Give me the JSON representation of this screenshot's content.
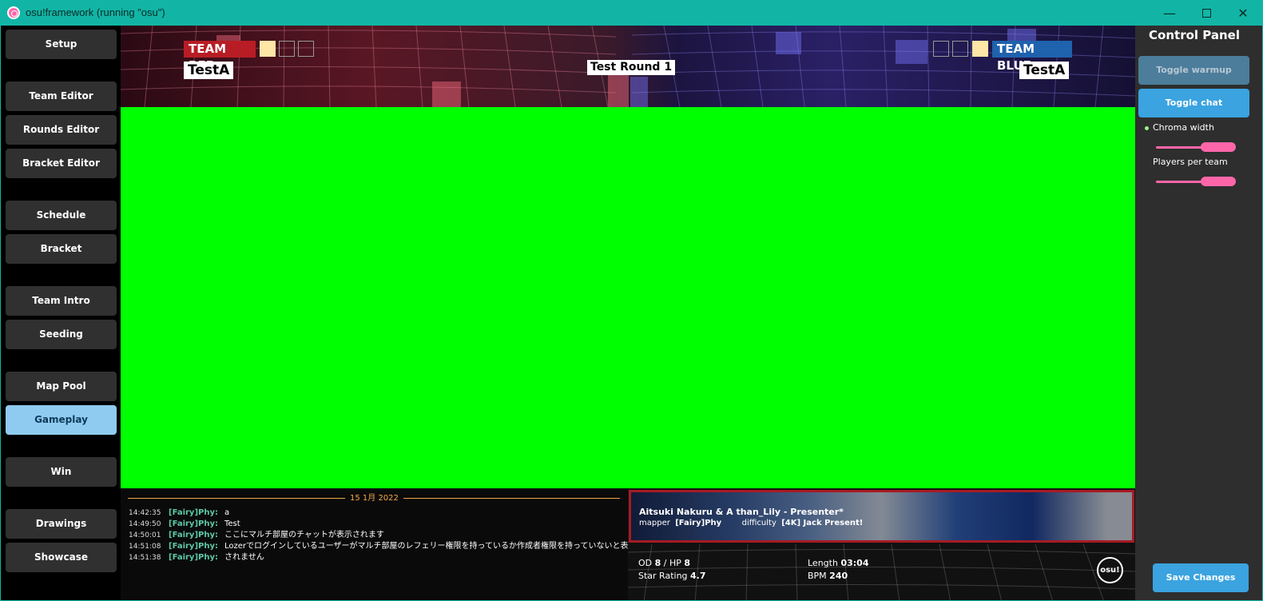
{
  "window": {
    "title": "osu!framework (running \"osu\")"
  },
  "sidebar": {
    "items": [
      {
        "label": "Setup",
        "active": false
      },
      {
        "label": "Team Editor",
        "active": false
      },
      {
        "label": "Rounds Editor",
        "active": false
      },
      {
        "label": "Bracket Editor",
        "active": false
      },
      {
        "label": "Schedule",
        "active": false
      },
      {
        "label": "Bracket",
        "active": false
      },
      {
        "label": "Team Intro",
        "active": false
      },
      {
        "label": "Seeding",
        "active": false
      },
      {
        "label": "Map Pool",
        "active": false
      },
      {
        "label": "Gameplay",
        "active": true
      },
      {
        "label": "Win",
        "active": false
      },
      {
        "label": "Drawings",
        "active": false
      },
      {
        "label": "Showcase",
        "active": false
      }
    ]
  },
  "header": {
    "team_red": {
      "label": "TEAM RED",
      "name": "TestA",
      "score_filled": 1,
      "score_total": 3
    },
    "team_blue": {
      "label": "TEAM BLUE",
      "name": "TestA",
      "score_filled": 1,
      "score_total": 3
    },
    "round": "Test Round 1"
  },
  "chat": {
    "date": "15 1月 2022",
    "messages": [
      {
        "time": "14:42:35",
        "user": "[Fairy]Phy:",
        "text": "a"
      },
      {
        "time": "14:49:50",
        "user": "[Fairy]Phy:",
        "text": "Test"
      },
      {
        "time": "14:50:01",
        "user": "[Fairy]Phy:",
        "text": "ここにマルチ部屋のチャットが表示されます"
      },
      {
        "time": "14:51:08",
        "user": "[Fairy]Phy:",
        "text": "Lozerでログインしているユーザーがマルチ部屋のレフェリー権限を持っているか作成者権限を持っていないと表示さ"
      },
      {
        "time": "14:51:38",
        "user": "[Fairy]Phy:",
        "text": "されません"
      }
    ]
  },
  "beatmap": {
    "title": "Aitsuki Nakuru & A than_Lily - Presenter*",
    "mapper_label": "mapper",
    "mapper": "[Fairy]Phy",
    "difficulty_label": "difficulty",
    "difficulty": "[4K] Jack Present!",
    "od_label": "OD",
    "od": "8",
    "hp_label": "/ HP",
    "hp": "8",
    "star_label": "Star Rating",
    "star": "4.7",
    "length_label": "Length",
    "length": "03:04",
    "bpm_label": "BPM",
    "bpm": "240",
    "logo": "osu!"
  },
  "control_panel": {
    "title": "Control Panel",
    "toggle_warmup": "Toggle warmup",
    "toggle_chat": "Toggle chat",
    "chroma_width_label": "Chroma width",
    "players_per_team_label": "Players per team",
    "save_changes": "Save Changes"
  },
  "colors": {
    "titlebar": "#12b5a5",
    "chroma": "#00ff00",
    "team_red": "#b81d25",
    "team_blue": "#1f62ad",
    "accent_blue": "#3aa3e0",
    "slider_pink": "#ff66aa",
    "chat_user": "#5ec8a8",
    "chat_date": "#f2a94a"
  }
}
